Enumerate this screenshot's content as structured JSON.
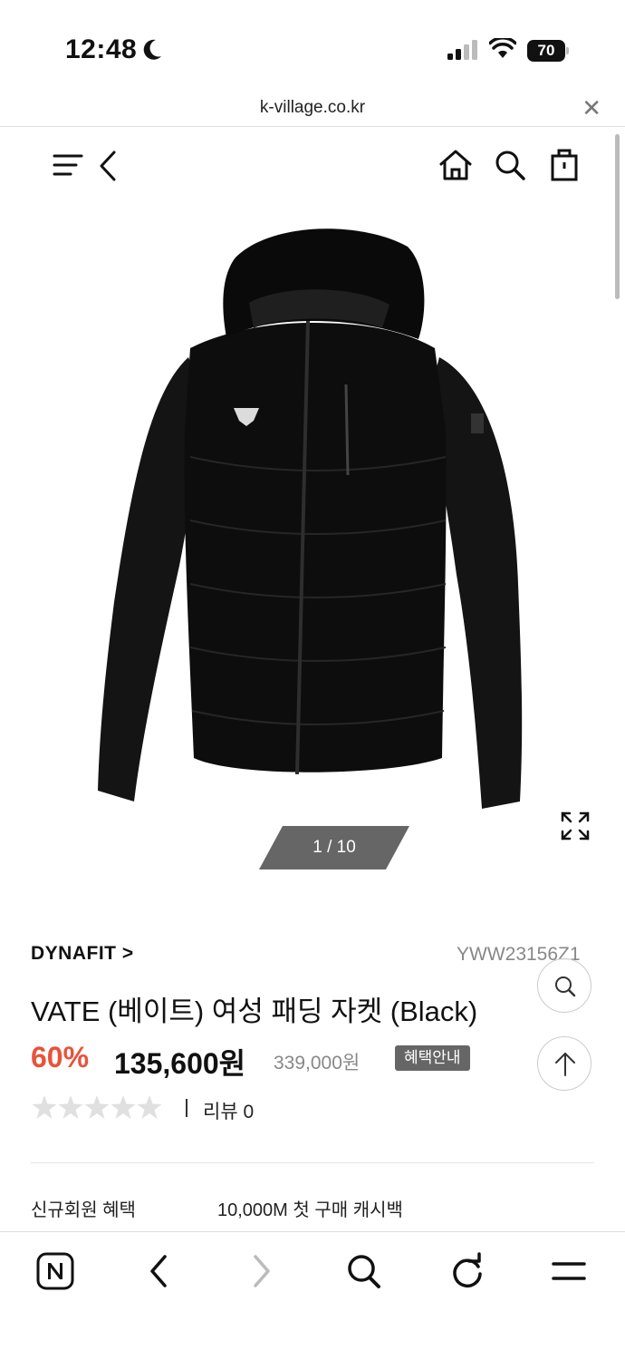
{
  "status_bar": {
    "time": "12:48",
    "battery": "70"
  },
  "browser": {
    "url": "k-village.co.kr"
  },
  "icons": {
    "menu": "menu-icon",
    "back": "chevron-left-icon",
    "home": "home-icon",
    "search": "search-icon",
    "cart": "shopping-bag-icon",
    "expand": "expand-icon",
    "zoom": "zoom-search-icon",
    "top": "arrow-up-icon"
  },
  "gallery": {
    "counter": "1 / 10"
  },
  "product": {
    "brand": "DYNAFIT >",
    "sku": "YWW23156Z1",
    "title": "VATE (베이트) 여성 패딩 자켓 (Black)",
    "discount": "60%",
    "price": "135,600원",
    "original_price": "339,000원",
    "benefit_button": "혜택안내",
    "rating": 0,
    "review": "리뷰 0"
  },
  "perks": [
    {
      "label": "신규회원 혜택",
      "value": "10,000M 첫 구매 캐시백"
    }
  ],
  "colors": {
    "accent": "#e8533a",
    "muted": "#888888",
    "badge": "#666666"
  }
}
